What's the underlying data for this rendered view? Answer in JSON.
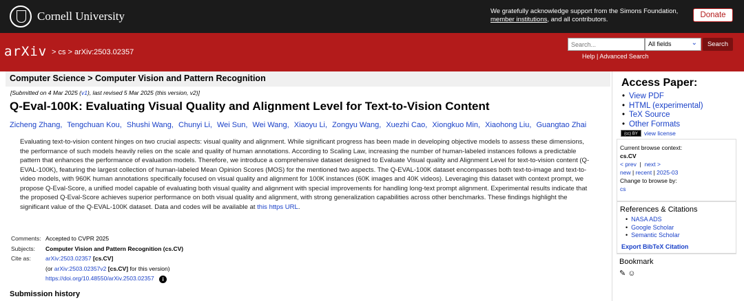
{
  "topbar": {
    "org_name": "Cornell University",
    "ack_text": "We gratefully acknowledge support from the Simons Foundation,",
    "ack_link": "member institutions",
    "ack_tail": ", and all contributors.",
    "donate_label": "Donate"
  },
  "header": {
    "logo": "arXiv",
    "breadcrumb": "> cs > arXiv:2503.02357",
    "search_placeholder": "Search...",
    "search_field": "All fields",
    "search_button": "Search",
    "help_link": "Help",
    "separator": "|",
    "advanced_link": "Advanced Search"
  },
  "paper": {
    "category_header": "Computer Science > Computer Vision and Pattern Recognition",
    "submitted_pre": "[Submitted on 4 Mar 2025 (",
    "submitted_v1": "v1",
    "submitted_post": "), last revised 5 Mar 2025 (this version, v2)]",
    "title": "Q-Eval-100K: Evaluating Visual Quality and Alignment Level for Text-to-Vision Content",
    "authors": [
      "Zicheng Zhang,",
      "Tengchuan Kou,",
      "Shushi Wang,",
      "Chunyi Li,",
      "Wei Sun,",
      "Wei Wang,",
      "Xiaoyu Li,",
      "Zongyu Wang,",
      "Xuezhi Cao,",
      "Xiongkuo Min,",
      "Xiaohong Liu,",
      "Guangtao Zhai"
    ],
    "abstract": "Evaluating text-to-vision content hinges on two crucial aspects: visual quality and alignment. While significant progress has been made in developing objective models to assess these dimensions, the performance of such models heavily relies on the scale and quality of human annotations. According to Scaling Law, increasing the number of human-labeled instances follows a predictable pattern that enhances the performance of evaluation models. Therefore, we introduce a comprehensive dataset designed to Evaluate Visual quality and Alignment Level for text-to-vision content (Q-EVAL-100K), featuring the largest collection of human-labeled Mean Opinion Scores (MOS) for the mentioned two aspects. The Q-EVAL-100K dataset encompasses both text-to-image and text-to-video models, with 960K human annotations specifically focused on visual quality and alignment for 100K instances (60K images and 40K videos). Leveraging this dataset with context prompt, we propose Q-Eval-Score, a unified model capable of evaluating both visual quality and alignment with special improvements for handling long-text prompt alignment. Experimental results indicate that the proposed Q-Eval-Score achieves superior performance on both visual quality and alignment, with strong generalization capabilities across other benchmarks. These findings highlight the significant value of the Q-EVAL-100K dataset. Data and codes will be available at",
    "abstract_link": "this https URL",
    "abstract_end": ".",
    "comments_label": "Comments:",
    "comments": "Accepted to CVPR 2025",
    "subjects_label": "Subjects:",
    "subjects": "Computer Vision and Pattern Recognition (cs.CV)",
    "cite_label": "Cite as:",
    "cite_id": "arXiv:2503.02357",
    "cite_cat": "[cs.CV]",
    "cite_alt_pre": "(or",
    "cite_alt_id": "arXiv:2503.02357v2",
    "cite_alt_cat": "[cs.CV]",
    "cite_alt_post": "for this version)",
    "doi": "https://doi.org/10.48550/arXiv.2503.02357",
    "submission_history": "Submission history"
  },
  "sidebar": {
    "access_title": "Access Paper:",
    "links": [
      "View PDF",
      "HTML (experimental)",
      "TeX Source",
      "Other Formats"
    ],
    "cc_badge": "(cc) BY",
    "view_license": "view license",
    "browse_context_label": "Current browse context:",
    "browse_context": "cs.CV",
    "prev": "< prev",
    "bar": "|",
    "next": "next >",
    "new": "new",
    "recent": "recent",
    "month": "2025-03",
    "change_browse": "Change to browse by:",
    "cs": "cs",
    "refs_title": "References & Citations",
    "refs": [
      "NASA ADS",
      "Google Scholar",
      "Semantic Scholar"
    ],
    "bibtex": "Export BibTeX Citation",
    "bookmark": "Bookmark"
  }
}
